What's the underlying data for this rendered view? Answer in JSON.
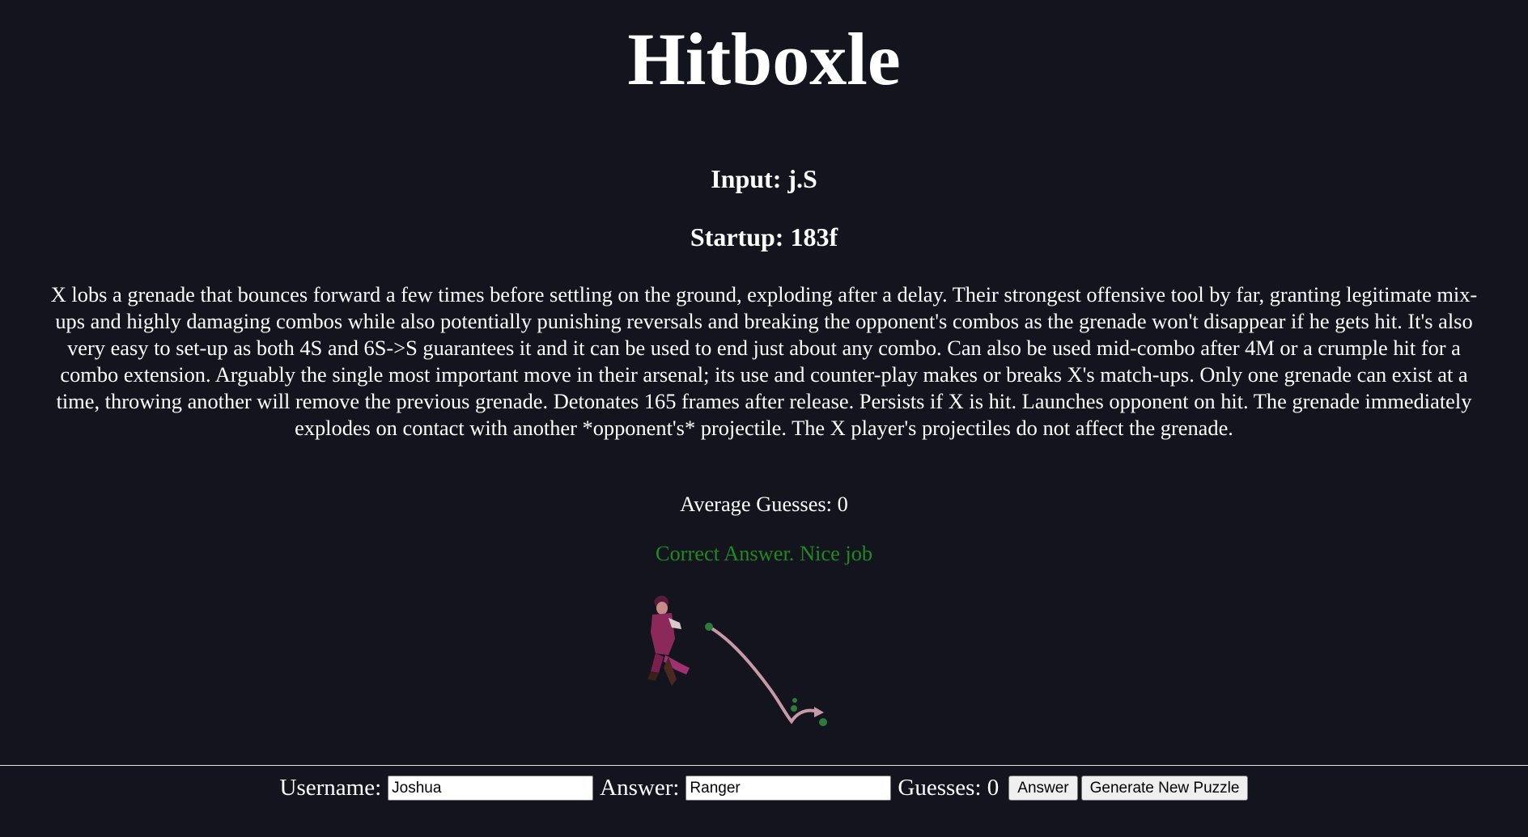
{
  "app": {
    "title": "Hitboxle"
  },
  "puzzle": {
    "input_label": "Input:",
    "input_value": "j.S",
    "startup_label": "Startup:",
    "startup_value": "183f",
    "description": "X lobs a grenade that bounces forward a few times before settling on the ground, exploding after a delay. Their strongest offensive tool by far, granting legitimate mix-ups and highly damaging combos while also potentially punishing reversals and breaking the opponent's combos as the grenade won't disappear if he gets hit. It's also very easy to set-up as both 4S and 6S->S guarantees it and it can be used to end just about any combo. Can also be used mid-combo after 4M or a crumple hit for a combo extension. Arguably the single most important move in their arsenal; its use and counter-play makes or breaks X's match-ups. Only one grenade can exist at a time, throwing another will remove the previous grenade. Detonates 165 frames after release. Persists if X is hit. Launches opponent on hit. The grenade immediately explodes on contact with another *opponent's* projectile. The X player's projectiles do not affect the grenade."
  },
  "stats": {
    "average_guesses_label": "Average Guesses:",
    "average_guesses_value": "0"
  },
  "result": {
    "message": "Correct Answer. Nice job",
    "color": "#1f8a1f"
  },
  "form": {
    "username_label": "Username:",
    "username_value": "Joshua",
    "answer_label": "Answer:",
    "answer_value": "Ranger",
    "guesses_label": "Guesses:",
    "guesses_value": "0",
    "answer_button": "Answer",
    "generate_button": "Generate New Puzzle"
  },
  "colors": {
    "background": "#13141e",
    "text": "#ffffff",
    "success": "#1f8a1f"
  }
}
